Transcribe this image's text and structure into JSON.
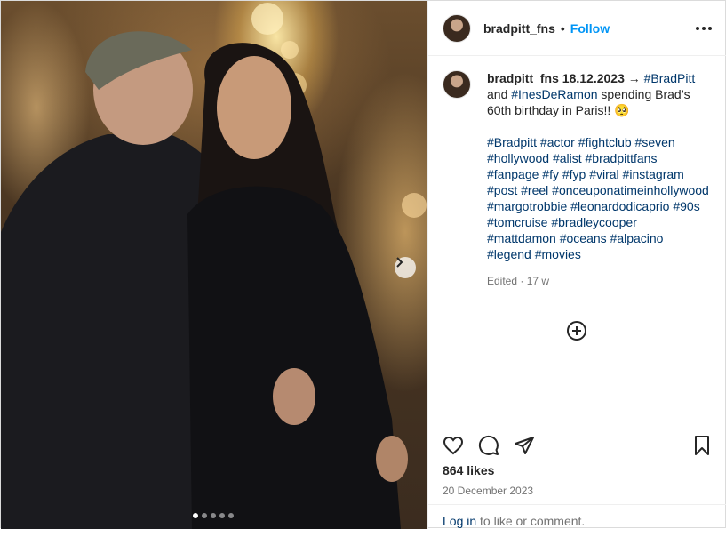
{
  "post": {
    "username": "bradpitt_fns",
    "follow_label": "Follow",
    "separator": "•",
    "caption": {
      "username": "bradpitt_fns",
      "date": "18.12.2023",
      "arrow": "→",
      "tag1": "#BradPitt",
      "and_text": "and",
      "tag2": "#InesDeRamon",
      "text": "spending Brad’s 60th birthday in Paris!! 🥺",
      "hashtags": "#Bradpitt #actor #fightclub #seven #hollywood #alist #bradpittfans #fanpage #fy #fyp #viral #instagram #post #reel #onceuponatimeinhollywood #margotrobbie #leonardodicaprio #90s #tomcruise #bradleycooper #mattdamon #oceans #alpacino #legend #movies",
      "edited": "Edited · 17 w"
    },
    "likes": "864 likes",
    "date": "20 December 2023",
    "login_link": "Log in",
    "login_text": " to like or comment.",
    "carousel": {
      "count": 5,
      "active": 0
    }
  },
  "icons": {
    "more": "more-options-icon",
    "next": "chevron-right-icon",
    "add": "add-circle-icon",
    "like": "heart-icon",
    "comment": "comment-icon",
    "share": "send-icon",
    "save": "bookmark-icon"
  }
}
